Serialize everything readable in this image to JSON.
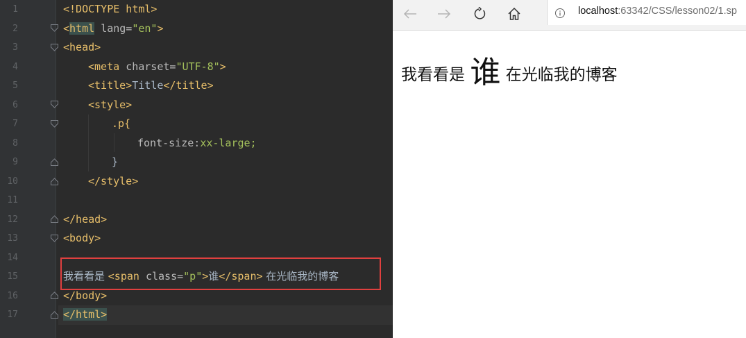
{
  "editor": {
    "line_numbers": [
      "1",
      "2",
      "3",
      "4",
      "5",
      "6",
      "7",
      "8",
      "9",
      "10",
      "11",
      "12",
      "13",
      "14",
      "15",
      "16",
      "17"
    ],
    "lines": {
      "l1": {
        "tag": "<!DOCTYPE html>"
      },
      "l2": {
        "open": "<",
        "name": "html",
        "space": " ",
        "attr": "lang=",
        "val": "\"en\"",
        "close": ">"
      },
      "l3": {
        "tag": "<head>"
      },
      "l4": {
        "open": "<meta ",
        "attr": "charset=",
        "val": "\"UTF-8\"",
        "close": ">"
      },
      "l5": {
        "open": "<title>",
        "text": "Title",
        "close": "</title>"
      },
      "l6": {
        "tag": "<style>"
      },
      "l7": {
        "sel": ".p{"
      },
      "l8": {
        "prop": "font-size:",
        "val": "xx-large;"
      },
      "l9": {
        "brace": "}"
      },
      "l10": {
        "tag": "</style>"
      },
      "l12": {
        "tag": "</head>"
      },
      "l13": {
        "tag": "<body>"
      },
      "l15": {
        "pre": "我看看是 ",
        "open": "<span ",
        "attr": "class=",
        "val": "\"p\"",
        "close": ">",
        "word": "谁",
        "end": "</span>",
        "post": " 在光临我的博客"
      },
      "l16": {
        "tag": "</body>"
      },
      "l17": {
        "tag": "</html>"
      }
    }
  },
  "browser": {
    "url_host": "localhost",
    "url_rest": ":63342/CSS/lesson02/1.sp",
    "content": {
      "before": "我看看是 ",
      "big": "谁",
      "after": " 在光临我的博客"
    }
  },
  "colors": {
    "editor_bg": "#2b2b2b",
    "tag": "#e8bf6a",
    "string": "#a5c25c",
    "highlight_box": "#e0403f"
  }
}
